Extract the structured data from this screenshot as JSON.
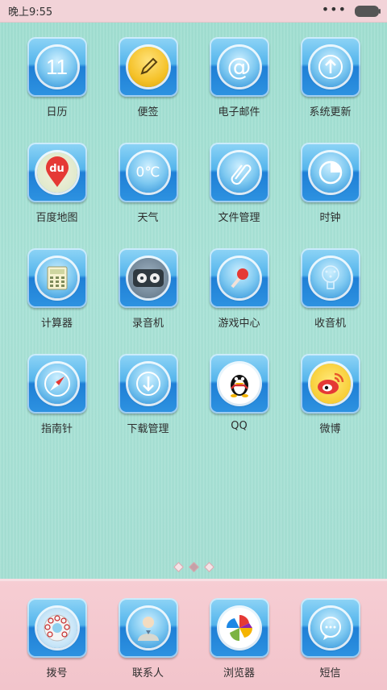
{
  "status_bar": {
    "time": "晚上9:55",
    "menu": "•••"
  },
  "apps": [
    {
      "label": "日历",
      "icon": "calendar-icon",
      "text": "11"
    },
    {
      "label": "便签",
      "icon": "notes-icon"
    },
    {
      "label": "电子邮件",
      "icon": "email-icon",
      "text": "@"
    },
    {
      "label": "系统更新",
      "icon": "update-icon"
    },
    {
      "label": "百度地图",
      "icon": "baidu-map-icon",
      "text": "du"
    },
    {
      "label": "天气",
      "icon": "weather-icon",
      "text": "0℃"
    },
    {
      "label": "文件管理",
      "icon": "file-manager-icon"
    },
    {
      "label": "时钟",
      "icon": "clock-icon"
    },
    {
      "label": "计算器",
      "icon": "calculator-icon"
    },
    {
      "label": "录音机",
      "icon": "recorder-icon"
    },
    {
      "label": "游戏中心",
      "icon": "game-center-icon"
    },
    {
      "label": "收音机",
      "icon": "radio-icon"
    },
    {
      "label": "指南针",
      "icon": "compass-icon"
    },
    {
      "label": "下载管理",
      "icon": "download-icon"
    },
    {
      "label": "QQ",
      "icon": "qq-icon"
    },
    {
      "label": "微博",
      "icon": "weibo-icon"
    }
  ],
  "dock": [
    {
      "label": "拨号",
      "icon": "phone-dial-icon"
    },
    {
      "label": "联系人",
      "icon": "contacts-icon"
    },
    {
      "label": "浏览器",
      "icon": "browser-icon"
    },
    {
      "label": "短信",
      "icon": "messages-icon"
    }
  ],
  "page_indicator": {
    "pages": 3,
    "current": 2
  },
  "colors": {
    "background": "#a6e0d4",
    "dock": "#f3c7ce",
    "status_bar": "#f2d3d8"
  }
}
